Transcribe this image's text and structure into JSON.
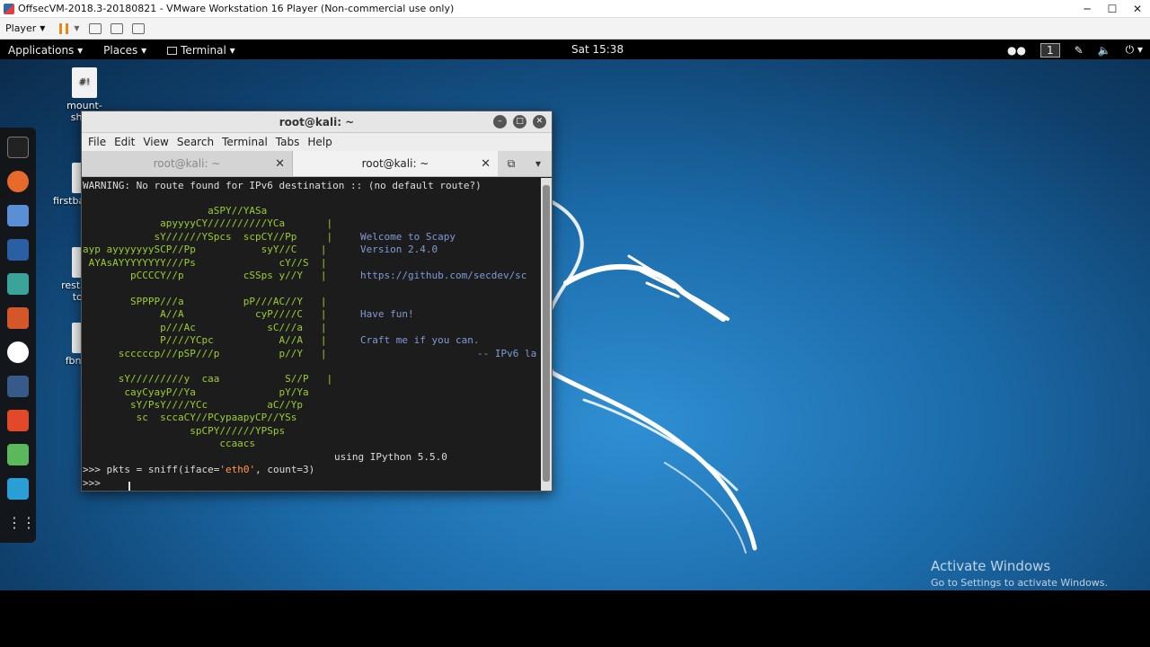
{
  "vmware": {
    "title": "OffsecVM-2018.3-20180821 - VMware Workstation 16 Player (Non-commercial use only)",
    "player_label": "Player",
    "min": "─",
    "max": "☐",
    "close": "✕"
  },
  "topbar": {
    "applications": "Applications ▾",
    "places": "Places ▾",
    "terminal": "Terminal ▾",
    "clock": "Sat 15:38",
    "workspace": "1"
  },
  "desktop_icons": [
    {
      "label": "mount-sha…",
      "glyph": "#!"
    },
    {
      "label": "firstbankenu…",
      "glyph": ""
    },
    {
      "label": "restaapy-tools",
      "glyph": ""
    },
    {
      "label": "fbnpyer",
      "glyph": ""
    }
  ],
  "terminal": {
    "title": "root@kali: ~",
    "menu": [
      "File",
      "Edit",
      "View",
      "Search",
      "Terminal",
      "Tabs",
      "Help"
    ],
    "tab_inactive": "root@kali: ~",
    "tab_active": "root@kali: ~",
    "tab_close": "✕",
    "warning": "WARNING: No route found for IPv6 destination :: (no default route?)",
    "art": [
      "                     aSPY//YASa",
      "             apyyyyCY//////////YCa       |",
      "            sY//////YSpcs  scpCY//Pp     | ",
      "ayp ayyyyyyySCP//Pp           syY//C    | ",
      " AYAsAYYYYYYYY///Ps              cY//S  |",
      "        pCCCCY//p          cSSps y//Y   | ",
      "",
      "        SPPPP///a          pP///AC//Y   |",
      "             A//A            cyP////C   | ",
      "             p///Ac            sC///a   |",
      "             P////YCpc           A//A   | ",
      "      scccccp///pSP///p          p//Y   |",
      "",
      "      sY/////////y  caa           S//P   |",
      "       cayCyayP//Ya              pY/Ya",
      "        sY/PsY////YCc          aC//Yp",
      "         sc  sccaCY//PCypaapyCP//YSs",
      "                  spCPY//////YPSps",
      "                       ccaacs"
    ],
    "info": {
      "welcome": "Welcome to Scapy",
      "version": "Version 2.4.0",
      "url": "https://github.com/secdev/sc",
      "fun": "Have fun!",
      "craft": "Craft me if you can.",
      "ipv6": "-- IPv6 la"
    },
    "ipython": "using IPython 5.5.0",
    "cmd_prefix": ">>> pkts = sniff(iface=",
    "cmd_str": "'eth0'",
    "cmd_suffix": ", count=3)",
    "prompt2": ">>>"
  },
  "watermark": {
    "line1": "Activate Windows",
    "line2": "Go to Settings to activate Windows."
  }
}
